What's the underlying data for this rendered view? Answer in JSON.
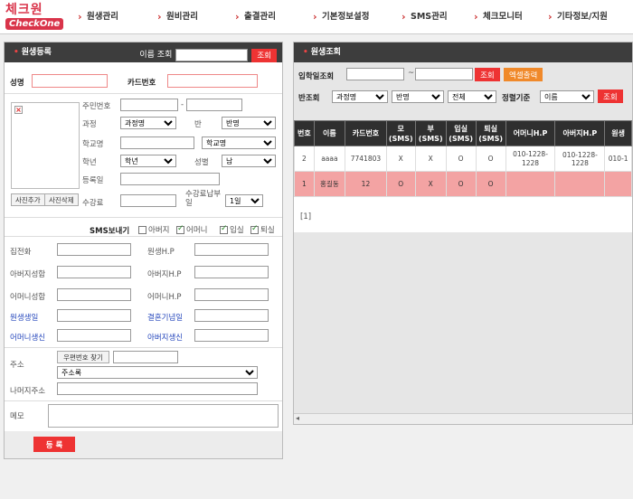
{
  "logo": {
    "top": "체크원",
    "bottom": "CheckOne"
  },
  "nav": [
    "원생관리",
    "원비관리",
    "출결관리",
    "기본정보설정",
    "SMS관리",
    "체크모니터",
    "기타정보/지원"
  ],
  "left": {
    "title": "원생등록",
    "name_search_label": "이름 조회",
    "search_btn": "조회",
    "name_label": "성명",
    "card_label": "카드번호",
    "jumin_label": "주민번호",
    "course_label": "과정",
    "course_value": "과정명",
    "class_label": "반",
    "class_value": "반명",
    "school_label": "학교명",
    "school_select": "학교명",
    "grade_label": "학년",
    "grade_value": "학년",
    "gender_label": "성별",
    "gender_value": "남",
    "regdate_label": "등록일",
    "photo_add": "사진추가",
    "photo_del": "사진삭제",
    "fee_label": "수강료",
    "due_label": "수강료납부일",
    "due_value": "1일",
    "sms_label": "SMS보내기",
    "sms_opts": [
      {
        "label": "아버지",
        "checked": false
      },
      {
        "label": "어머니",
        "checked": true
      },
      {
        "label": "입실",
        "checked": true
      },
      {
        "label": "퇴실",
        "checked": true
      }
    ],
    "home_tel": "집전화",
    "student_hp": "원생H.P",
    "father_name": "아버지성함",
    "father_hp": "아버지H.P",
    "mother_name": "어머니성함",
    "mother_hp": "어머니H.P",
    "birthday": "원생생일",
    "anniversary": "결혼기념일",
    "mother_bday": "어머니생신",
    "father_bday": "아버지생신",
    "address_label": "주소",
    "zip_btn": "우편번호 찾기",
    "address_select": "주소록",
    "address_rest": "나머지주소",
    "memo_label": "메모",
    "register_btn": "등 록"
  },
  "right": {
    "title": "원생조회",
    "enroll_label": "입학일조회",
    "tilde": "~",
    "search_btn": "조회",
    "excel_btn": "엑셀출력",
    "class_search_label": "반조회",
    "course_value": "과정명",
    "class_value": "반명",
    "all_value": "전체",
    "sort_label": "정렬기준",
    "sort_value": "이름",
    "search_btn2": "조회",
    "headers": [
      "번호",
      "이름",
      "카드번호",
      "모(SMS)",
      "부(SMS)",
      "입실(SMS)",
      "퇴실(SMS)",
      "어머니H.P",
      "아버지H.P",
      "원생"
    ],
    "rows": [
      [
        "2",
        "aaaa",
        "7741803",
        "X",
        "X",
        "O",
        "O",
        "010-1228-1228",
        "010-1228-1228",
        "010-1"
      ],
      [
        "1",
        "홍길동",
        "12",
        "O",
        "X",
        "O",
        "O",
        "",
        "",
        ""
      ]
    ],
    "pager": "[1]"
  }
}
